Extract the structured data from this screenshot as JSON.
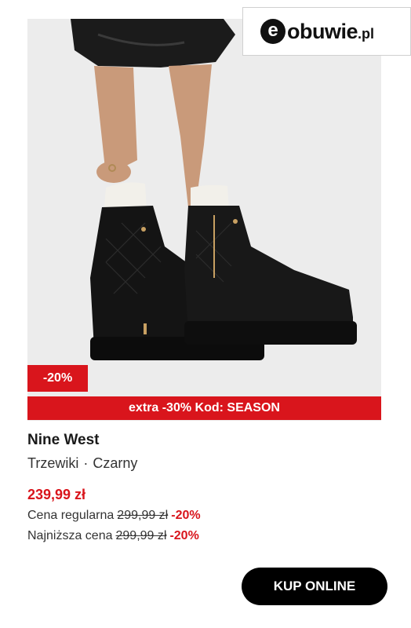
{
  "logo": {
    "mark": "e",
    "name": "obuwie",
    "tld": ".pl"
  },
  "badge": {
    "discount": "-20%"
  },
  "promo": {
    "text": "extra -30% Kod: SEASON"
  },
  "product": {
    "brand": "Nine West",
    "category": "Trzewiki",
    "separator": "·",
    "color": "Czarny",
    "price": "239,99 zł",
    "regular_label": "Cena regularna",
    "regular_price": "299,99 zł",
    "regular_pct": "-20%",
    "lowest_label": "Najniższa cena",
    "lowest_price": "299,99 zł",
    "lowest_pct": "-20%"
  },
  "cta": {
    "label": "KUP ONLINE"
  },
  "colors": {
    "accent": "#d9151c",
    "button": "#000000"
  }
}
